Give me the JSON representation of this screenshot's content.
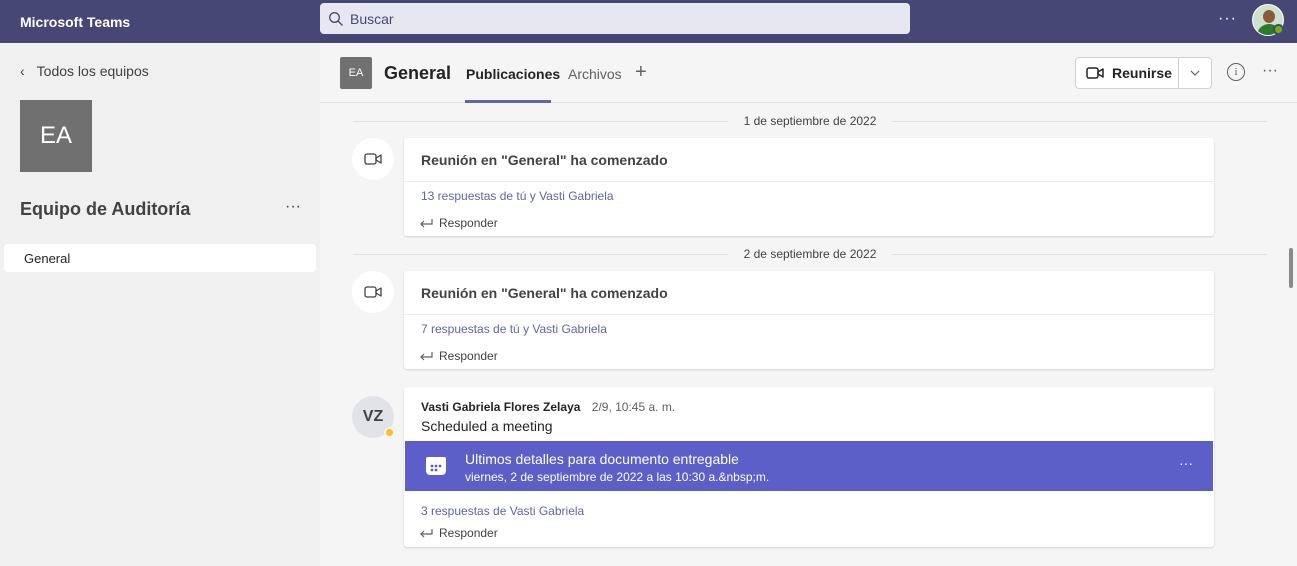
{
  "app": {
    "title": "Microsoft Teams"
  },
  "search": {
    "placeholder": "Buscar"
  },
  "top": {
    "more": "···"
  },
  "left": {
    "back_label": "Todos los equipos",
    "team_initials": "EA",
    "team_name": "Equipo de Auditoría",
    "team_more": "···",
    "channels": [
      {
        "label": "General"
      }
    ]
  },
  "header": {
    "tile": "EA",
    "channel": "General",
    "tabs": [
      {
        "label": "Publicaciones"
      },
      {
        "label": "Archivos"
      }
    ],
    "add_tab": "+",
    "meet_label": "Reunirse",
    "info": "i",
    "more": "···"
  },
  "feed": {
    "dates": [
      "1 de septiembre de 2022",
      "2 de septiembre de 2022"
    ],
    "posts": [
      {
        "title": "Reunión en \"General\" ha comenzado",
        "replies": "13 respuestas de tú y Vasti Gabriela",
        "reply_label": "Responder"
      },
      {
        "title": "Reunión en \"General\" ha comenzado",
        "replies": "7 respuestas de tú y Vasti Gabriela",
        "reply_label": "Responder"
      }
    ],
    "message": {
      "initials": "VZ",
      "author": "Vasti Gabriela Flores Zelaya",
      "time": "2/9, 10:45 a. m.",
      "text": "Scheduled a meeting",
      "meeting_title": "Ultimos detalles para documento entregable",
      "meeting_date": "viernes, 2 de septiembre de 2022 a las 10:30 a.&nbsp;m.",
      "meeting_more": "···",
      "replies": "3 respuestas de Vasti Gabriela",
      "reply_label": "Responder"
    }
  },
  "colors": {
    "topbar": "#464775",
    "accent": "#6264a7",
    "meeting_banner": "#5b5fc7",
    "presence_available": "#6bb700",
    "presence_away": "#fcc022"
  },
  "icons": [
    "search-icon",
    "more-icon",
    "chevron-left-icon",
    "video-camera-icon",
    "chevron-down-icon",
    "info-icon",
    "reply-icon",
    "calendar-icon"
  ]
}
